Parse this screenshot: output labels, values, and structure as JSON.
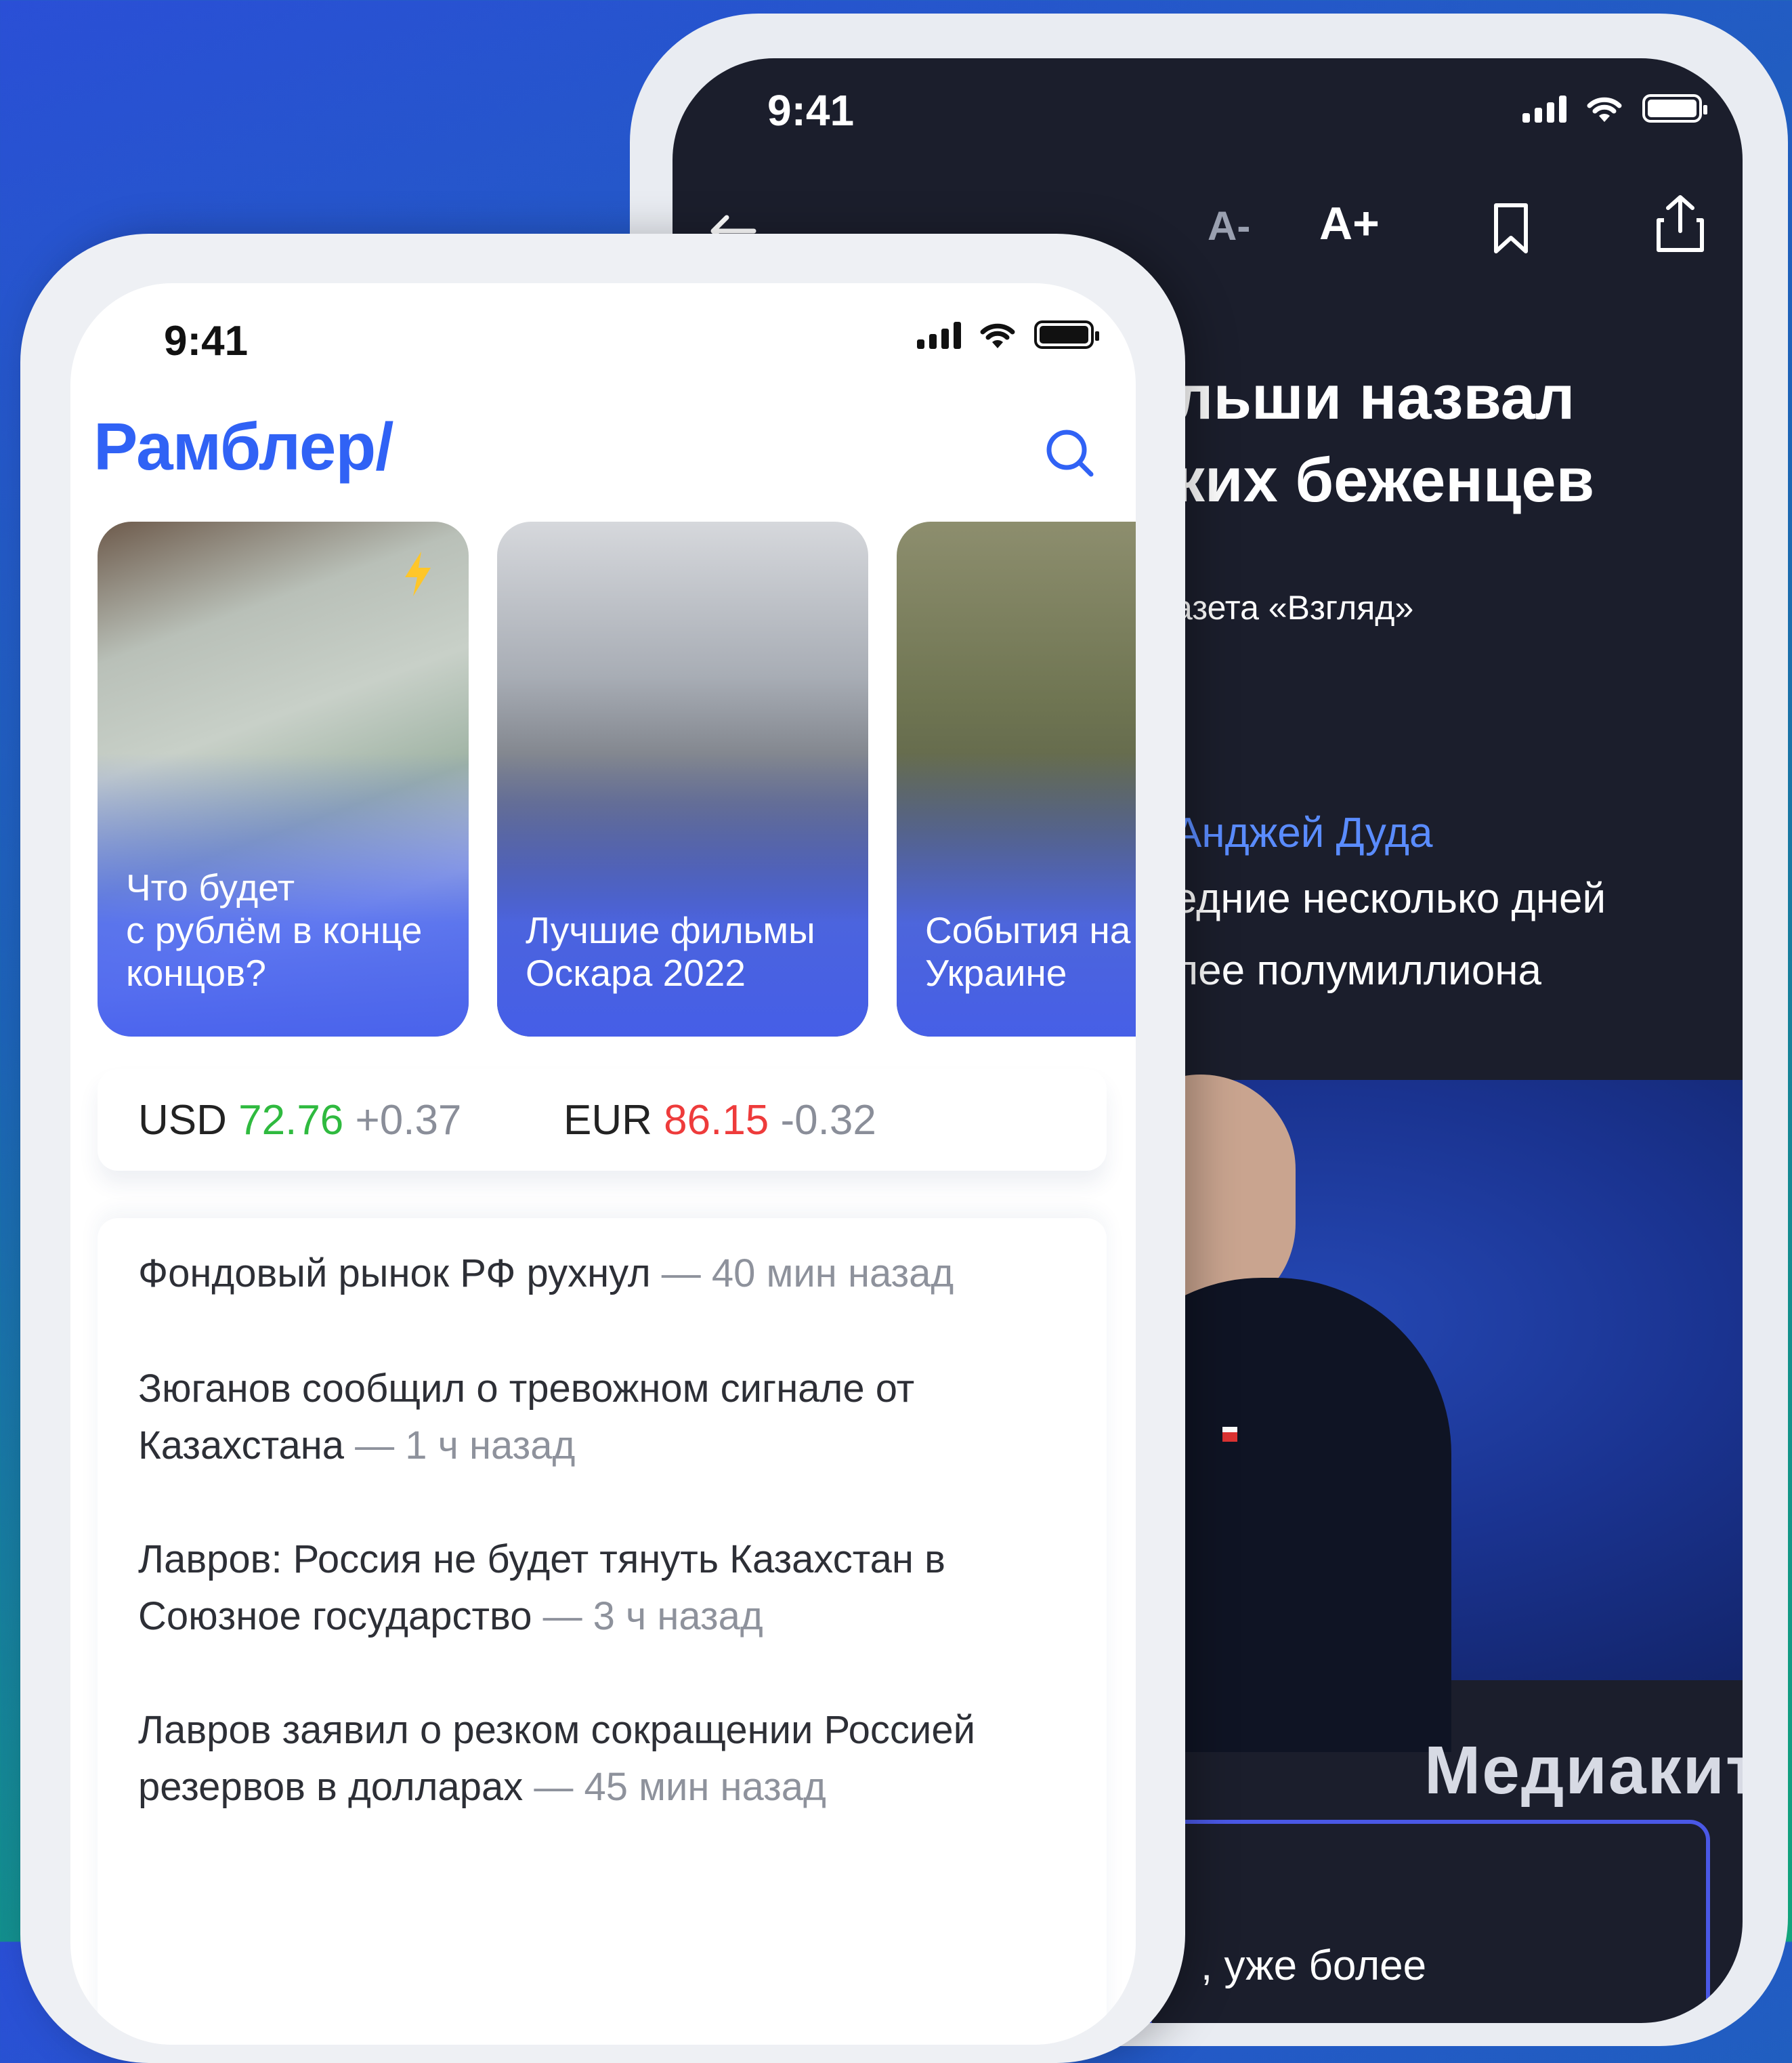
{
  "back_phone": {
    "status": {
      "time": "9:41"
    },
    "toolbar": {
      "back_icon": "arrow-left-icon",
      "font_decrease": "A-",
      "font_increase": "A+",
      "bookmark_icon": "bookmark-icon",
      "share_icon": "share-icon"
    },
    "article": {
      "title": "льши назвал\nких беженцев",
      "source": "азета «Взгляд»",
      "author": "Анджей Дуда",
      "paragraph": "едние несколько дней\nлее полумиллиона",
      "overlay_label": "Медиакит",
      "bottom_text": ", уже более"
    }
  },
  "front_phone": {
    "status": {
      "time": "9:41"
    },
    "header": {
      "logo": "Рамблер/",
      "search_icon": "search-icon"
    },
    "stories": [
      {
        "caption": "Что будет\nс рублём в конце\nконцов?",
        "badge_icon": "lightning-icon"
      },
      {
        "caption": "Лучшие фильмы\nОскара 2022"
      },
      {
        "caption": "События на\nУкраине"
      }
    ],
    "rates": [
      {
        "currency": "USD",
        "value": "72.76",
        "change": "+0.37",
        "trend": "up"
      },
      {
        "currency": "EUR",
        "value": "86.15",
        "change": "-0.32",
        "trend": "down"
      }
    ],
    "news": [
      {
        "title": "Фондовый рынок РФ рухнул",
        "time": " — 40 мин назад"
      },
      {
        "title": "Зюганов сообщил о тревожном сигнале от Казахстана",
        "time": " — 1 ч назад"
      },
      {
        "title": "Лавров: Россия не будет тянуть Казахстан в Союзное государство",
        "time": " — 3 ч назад"
      },
      {
        "title": "Лавров заявил о резком сокращении Россией резервов в долларах",
        "time": " — 45 мин назад"
      }
    ]
  },
  "colors": {
    "brand_blue": "#3062f5",
    "rate_up": "#2fba3f",
    "rate_down": "#ee3b3b",
    "dark_bg": "#1b1e2c",
    "link_blue": "#5a8cff"
  }
}
